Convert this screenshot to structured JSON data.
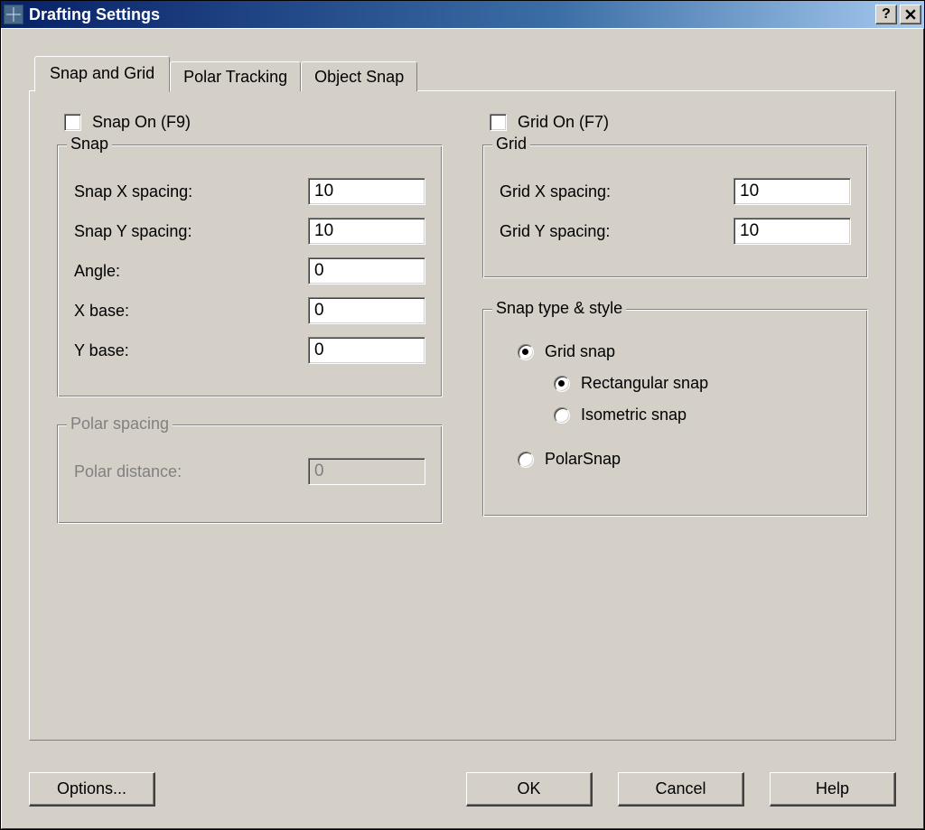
{
  "title": "Drafting Settings",
  "tabs": [
    "Snap and Grid",
    "Polar Tracking",
    "Object Snap"
  ],
  "activeTab": 0,
  "snapOnLabel": "Snap On (F9)",
  "gridOnLabel": "Grid On (F7)",
  "snapGroup": {
    "title": "Snap",
    "fields": {
      "snap_x_label": "Snap X spacing:",
      "snap_x_value": "10",
      "snap_y_label": "Snap Y spacing:",
      "snap_y_value": "10",
      "angle_label": "Angle:",
      "angle_value": "0",
      "xbase_label": "X base:",
      "xbase_value": "0",
      "ybase_label": "Y base:",
      "ybase_value": "0"
    }
  },
  "polarGroup": {
    "title": "Polar spacing",
    "dist_label": "Polar distance:",
    "dist_value": "0"
  },
  "gridGroup": {
    "title": "Grid",
    "grid_x_label": "Grid X spacing:",
    "grid_x_value": "10",
    "grid_y_label": "Grid Y spacing:",
    "grid_y_value": "10"
  },
  "styleGroup": {
    "title": "Snap type & style",
    "grid_snap": "Grid snap",
    "rect_snap": "Rectangular snap",
    "iso_snap": "Isometric snap",
    "polar_snap": "PolarSnap"
  },
  "buttons": {
    "options": "Options...",
    "ok": "OK",
    "cancel": "Cancel",
    "help": "Help"
  }
}
